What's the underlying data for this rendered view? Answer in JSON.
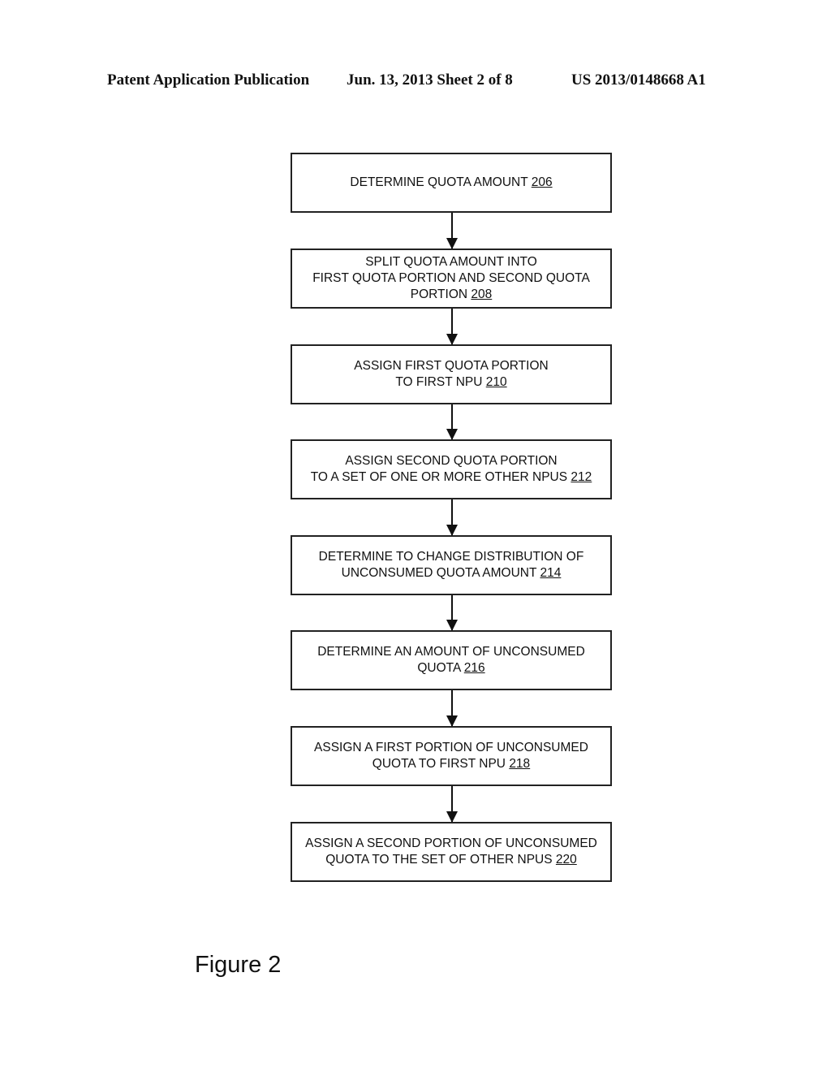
{
  "header": {
    "left": "Patent Application Publication",
    "middle": "Jun. 13, 2013  Sheet 2 of 8",
    "right": "US 2013/0148668 A1"
  },
  "flowchart": {
    "steps": [
      {
        "lines": [
          "DETERMINE QUOTA AMOUNT"
        ],
        "ref": "206"
      },
      {
        "lines": [
          "SPLIT QUOTA AMOUNT INTO",
          "FIRST QUOTA PORTION AND SECOND QUOTA",
          "PORTION"
        ],
        "ref": "208"
      },
      {
        "lines": [
          "ASSIGN FIRST QUOTA PORTION",
          "TO FIRST NPU"
        ],
        "ref": "210"
      },
      {
        "lines": [
          "ASSIGN SECOND QUOTA PORTION",
          "TO A SET OF ONE OR MORE OTHER NPUS"
        ],
        "ref": "212"
      },
      {
        "lines": [
          "DETERMINE TO CHANGE DISTRIBUTION OF",
          "UNCONSUMED QUOTA AMOUNT"
        ],
        "ref": "214"
      },
      {
        "lines": [
          "DETERMINE AN AMOUNT OF UNCONSUMED",
          "QUOTA"
        ],
        "ref": "216"
      },
      {
        "lines": [
          "ASSIGN A FIRST PORTION OF UNCONSUMED",
          "QUOTA TO FIRST NPU"
        ],
        "ref": "218"
      },
      {
        "lines": [
          "ASSIGN A SECOND PORTION OF UNCONSUMED",
          "QUOTA TO THE SET OF OTHER NPUS"
        ],
        "ref": "220"
      }
    ]
  },
  "figure_label": "Figure 2"
}
